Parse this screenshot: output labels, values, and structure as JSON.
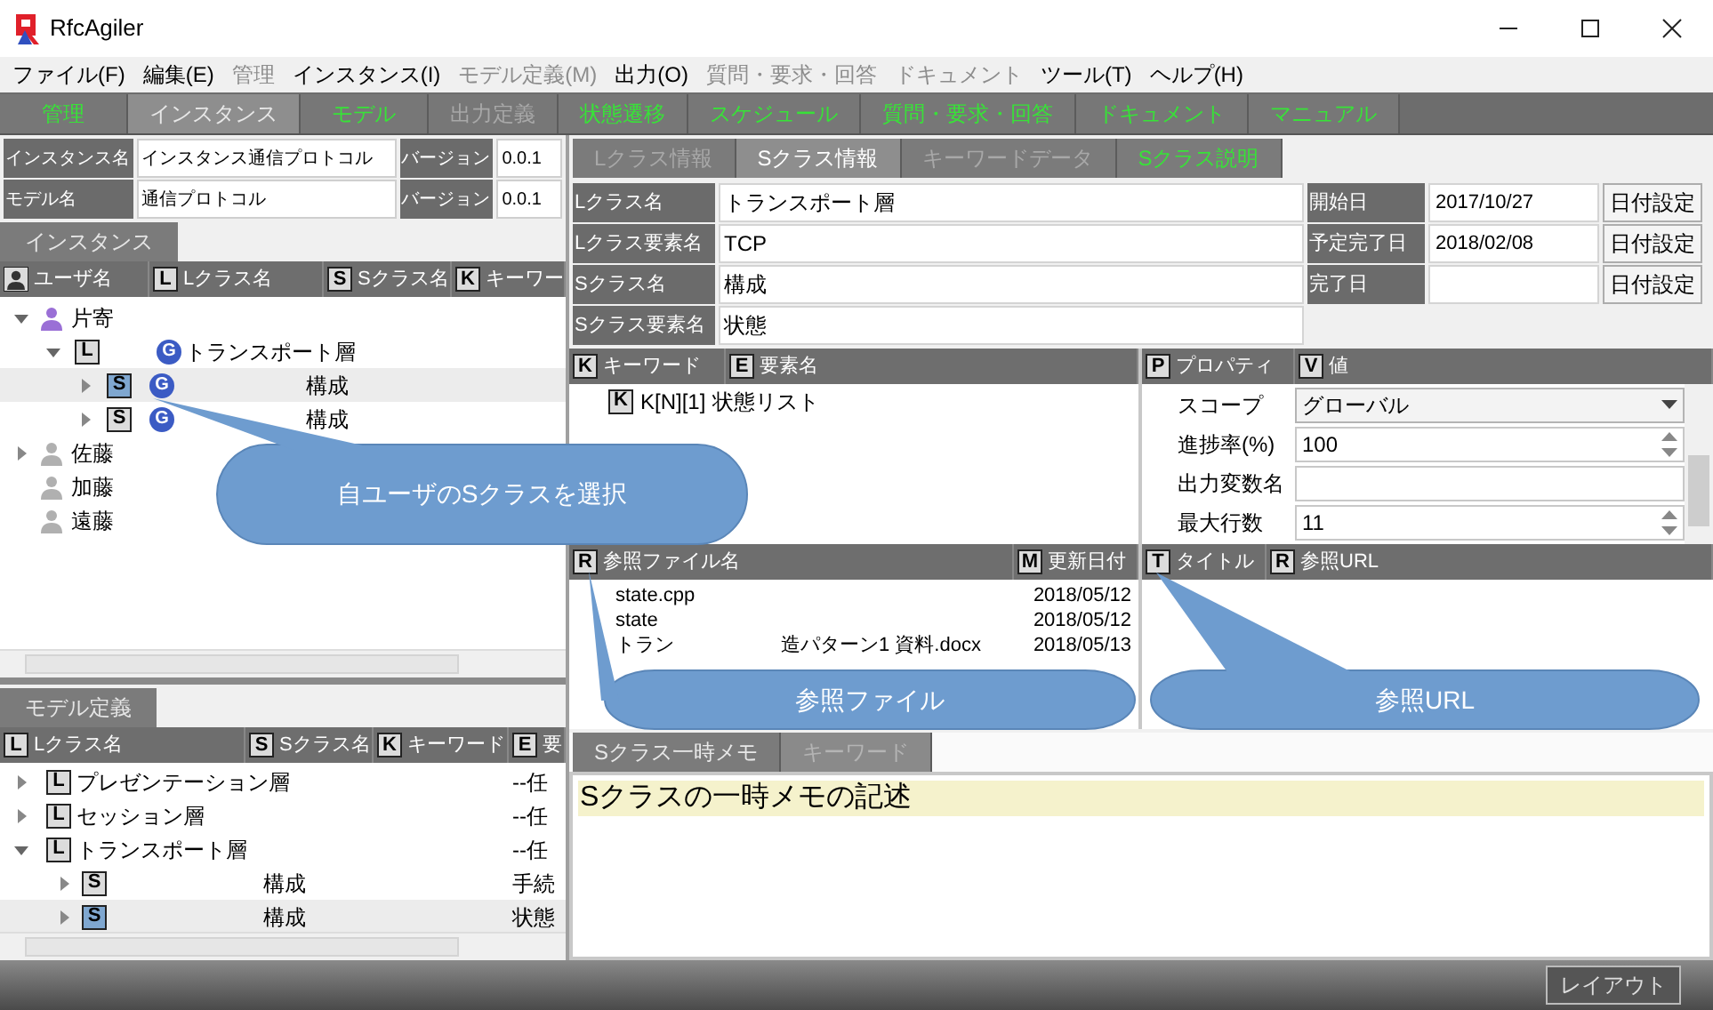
{
  "window": {
    "title": "RfcAgiler"
  },
  "menu": [
    {
      "label": "ファイル(F)",
      "disabled": false
    },
    {
      "label": "編集(E)",
      "disabled": false
    },
    {
      "label": "管理",
      "disabled": true
    },
    {
      "label": "インスタンス(I)",
      "disabled": false
    },
    {
      "label": "モデル定義(M)",
      "disabled": true
    },
    {
      "label": "出力(O)",
      "disabled": false
    },
    {
      "label": "質問・要求・回答",
      "disabled": true
    },
    {
      "label": "ドキュメント",
      "disabled": true
    },
    {
      "label": "ツール(T)",
      "disabled": false
    },
    {
      "label": "ヘルプ(H)",
      "disabled": false
    }
  ],
  "main_tabs": [
    {
      "label": "管理",
      "selected": false,
      "disabled": false
    },
    {
      "label": "インスタンス",
      "selected": true,
      "disabled": false
    },
    {
      "label": "モデル",
      "selected": false,
      "disabled": false
    },
    {
      "label": "出力定義",
      "selected": false,
      "disabled": true
    },
    {
      "label": "状態遷移",
      "selected": false,
      "disabled": false
    },
    {
      "label": "スケジュール",
      "selected": false,
      "disabled": false
    },
    {
      "label": "質問・要求・回答",
      "selected": false,
      "disabled": false
    },
    {
      "label": "ドキュメント",
      "selected": false,
      "disabled": false
    },
    {
      "label": "マニュアル",
      "selected": false,
      "disabled": false
    }
  ],
  "instance_fields": [
    {
      "label": "インスタンス名",
      "value": "インスタンス通信プロトコル",
      "version_label": "バージョン",
      "version": "0.0.1"
    },
    {
      "label": "モデル名",
      "value": "通信プロトコル",
      "version_label": "バージョン",
      "version": "0.0.1"
    }
  ],
  "instance_panel": {
    "tab": "インスタンス",
    "columns": [
      {
        "kind": "user",
        "label": "ユーザ名"
      },
      {
        "kind": "badge",
        "badge": "L",
        "label": "Lクラス名"
      },
      {
        "kind": "badge",
        "badge": "S",
        "label": "Sクラス名"
      },
      {
        "kind": "badge",
        "badge": "K",
        "label": "キーワー"
      }
    ],
    "tree": [
      {
        "kind": "user",
        "name": "片寄",
        "own": true,
        "expandable": true,
        "expanded": true,
        "selected": false,
        "children": [
          {
            "kind": "lclass",
            "badge": "L",
            "scope": "G",
            "name": "トランスポート層",
            "expandable": true,
            "expanded": true,
            "selected": false,
            "children": [
              {
                "kind": "sclass",
                "badge": "S",
                "scope": "G",
                "name": "構成",
                "expandable": true,
                "expanded": false,
                "selected": true
              },
              {
                "kind": "sclass",
                "badge": "S",
                "scope": "G",
                "name": "構成",
                "expandable": true,
                "expanded": false,
                "selected": false
              }
            ]
          }
        ]
      },
      {
        "kind": "user",
        "name": "佐藤",
        "own": false,
        "expandable": true,
        "expanded": false,
        "selected": false
      },
      {
        "kind": "user",
        "name": "加藤",
        "own": false,
        "expandable": false,
        "selected": false
      },
      {
        "kind": "user",
        "name": "遠藤",
        "own": false,
        "expandable": false,
        "selected": false
      }
    ]
  },
  "model_panel": {
    "tab": "モデル定義",
    "columns": [
      {
        "badge": "L",
        "label": "Lクラス名"
      },
      {
        "badge": "S",
        "label": "Sクラス名"
      },
      {
        "badge": "K",
        "label": "キーワード"
      },
      {
        "badge": "E",
        "label": "要"
      }
    ],
    "tree": [
      {
        "kind": "lclass",
        "badge": "L",
        "name": "プレゼンテーション層",
        "column_4": "--任",
        "expandable": true,
        "expanded": false,
        "selected": false
      },
      {
        "kind": "lclass",
        "badge": "L",
        "name": "セッション層",
        "column_4": "--任",
        "expandable": true,
        "expanded": false,
        "selected": false
      },
      {
        "kind": "lclass",
        "badge": "L",
        "name": "トランスポート層",
        "column_4": "--任",
        "expandable": true,
        "expanded": true,
        "selected": false,
        "children": [
          {
            "kind": "sclass",
            "badge": "S",
            "name": "構成",
            "column_4": "手続",
            "expandable": true,
            "expanded": false,
            "selected": false
          },
          {
            "kind": "sclass",
            "badge": "S",
            "name": "構成",
            "column_4": "状態",
            "expandable": true,
            "expanded": false,
            "selected": true
          }
        ]
      }
    ]
  },
  "info_tabs": [
    {
      "label": "Lクラス情報",
      "selected": false,
      "disabled": true
    },
    {
      "label": "Sクラス情報",
      "selected": true,
      "disabled": false
    },
    {
      "label": "キーワードデータ",
      "selected": false,
      "disabled": true
    },
    {
      "label": "Sクラス説明",
      "selected": false,
      "disabled": false
    }
  ],
  "class_form": [
    {
      "label": "Lクラス名",
      "value": "トランスポート層",
      "date_label": "開始日",
      "date": "2017/10/27",
      "button": "日付設定"
    },
    {
      "label": "Lクラス要素名",
      "value": "TCP",
      "date_label": "予定完了日",
      "date": "2018/02/08",
      "button": "日付設定"
    },
    {
      "label": "Sクラス名",
      "value": "構成",
      "date_label": "完了日",
      "button": "日付設定"
    },
    {
      "label": "Sクラス要素名",
      "value": "状態"
    }
  ],
  "keyword_panel": {
    "columns": [
      {
        "badge": "K",
        "label": "キーワード"
      },
      {
        "badge": "E",
        "label": "要素名"
      }
    ],
    "rows": [
      {
        "badge": "K",
        "keyword": "K[N][1]",
        "element": "状態リスト"
      }
    ]
  },
  "property_panel": {
    "columns": [
      {
        "badge": "P",
        "label": "プロパティ"
      },
      {
        "badge": "V",
        "label": "値"
      }
    ],
    "rows": [
      {
        "kind": "dropdown",
        "label": "スコープ",
        "value": "グローバル"
      },
      {
        "kind": "spinner",
        "label": "進捗率(%)",
        "value": "100"
      },
      {
        "kind": "text",
        "label": "出力変数名"
      },
      {
        "kind": "spinner",
        "label": "最大行数",
        "value": "11"
      }
    ]
  },
  "reference_files": {
    "columns": [
      {
        "badge": "R",
        "label": "参照ファイル名"
      },
      {
        "badge": "M",
        "label": "更新日付"
      }
    ],
    "rows": [
      {
        "name": "state.cpp",
        "date": "2018/05/12"
      },
      {
        "name": "state",
        "date": "2018/05/12"
      },
      {
        "name": "トラン",
        "name_after": "造パターン1 資料.docx",
        "date": "2018/05/13"
      }
    ]
  },
  "reference_urls": {
    "columns": [
      {
        "badge": "T",
        "label": "タイトル"
      },
      {
        "badge": "R",
        "label": "参照URL"
      }
    ]
  },
  "memo_tabs": [
    {
      "label": "Sクラス一時メモ",
      "selected": true,
      "disabled": false
    },
    {
      "label": "キーワード",
      "selected": false,
      "disabled": true
    }
  ],
  "memo": {
    "lines": [
      {
        "text": "Sクラスの一時メモの記述",
        "highlighted": true
      }
    ]
  },
  "status_bar": {
    "button": "レイアウト"
  },
  "callouts": [
    {
      "text": "自ユーザのSクラスを選択"
    },
    {
      "text": "参照ファイル"
    },
    {
      "text": "参照URL"
    }
  ]
}
